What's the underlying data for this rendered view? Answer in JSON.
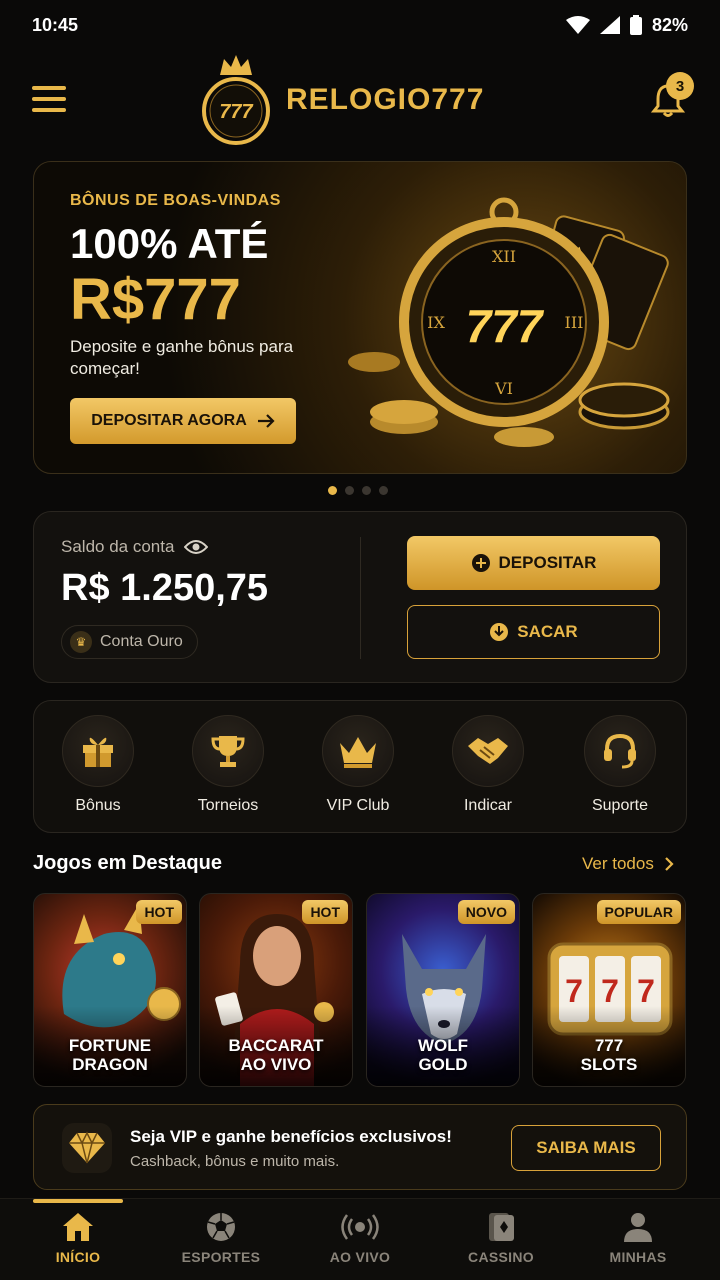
{
  "status": {
    "time": "10:45",
    "battery": "82%"
  },
  "header": {
    "logo_text": "RELOGIO777",
    "logo_badge": "777",
    "notifications": "3"
  },
  "banner": {
    "kicker": "BÔNUS DE BOAS-VINDAS",
    "title": "100% ATÉ",
    "amount": "R$777",
    "description": "Deposite e ganhe bônus para começar!",
    "cta": "DEPOSITAR AGORA",
    "art_text": "777"
  },
  "balance": {
    "label": "Saldo da conta",
    "value": "R$ 1.250,75",
    "tier": "Conta Ouro",
    "deposit": "DEPOSITAR",
    "withdraw": "SACAR"
  },
  "quick_actions": [
    {
      "label": "Bônus",
      "icon": "gift-icon"
    },
    {
      "label": "Torneios",
      "icon": "trophy-icon"
    },
    {
      "label": "VIP Club",
      "icon": "crown-icon"
    },
    {
      "label": "Indicar",
      "icon": "handshake-icon"
    },
    {
      "label": "Suporte",
      "icon": "headset-icon"
    }
  ],
  "games": {
    "title": "Jogos em Destaque",
    "see_all": "Ver todos",
    "items": [
      {
        "line1": "FORTUNE",
        "line2": "DRAGON",
        "tag": "HOT"
      },
      {
        "line1": "BACCARAT",
        "line2": "AO VIVO",
        "tag": "HOT"
      },
      {
        "line1": "WOLF",
        "line2": "GOLD",
        "tag": "NOVO"
      },
      {
        "line1": "777",
        "line2": "SLOTS",
        "tag": "POPULAR"
      }
    ]
  },
  "vip": {
    "title": "Seja VIP e ganhe benefícios exclusivos!",
    "subtitle": "Cashback, bônus e muito mais.",
    "cta": "SAIBA MAIS"
  },
  "nav": [
    {
      "label": "INÍCIO",
      "icon": "home-icon",
      "active": true
    },
    {
      "label": "ESPORTES",
      "icon": "soccer-ball-icon"
    },
    {
      "label": "AO VIVO",
      "icon": "live-broadcast-icon"
    },
    {
      "label": "CASSINO",
      "icon": "cards-icon"
    },
    {
      "label": "MINHAS",
      "icon": "user-icon"
    }
  ],
  "colors": {
    "accent": "#e9b84a",
    "background": "#0a0908"
  }
}
